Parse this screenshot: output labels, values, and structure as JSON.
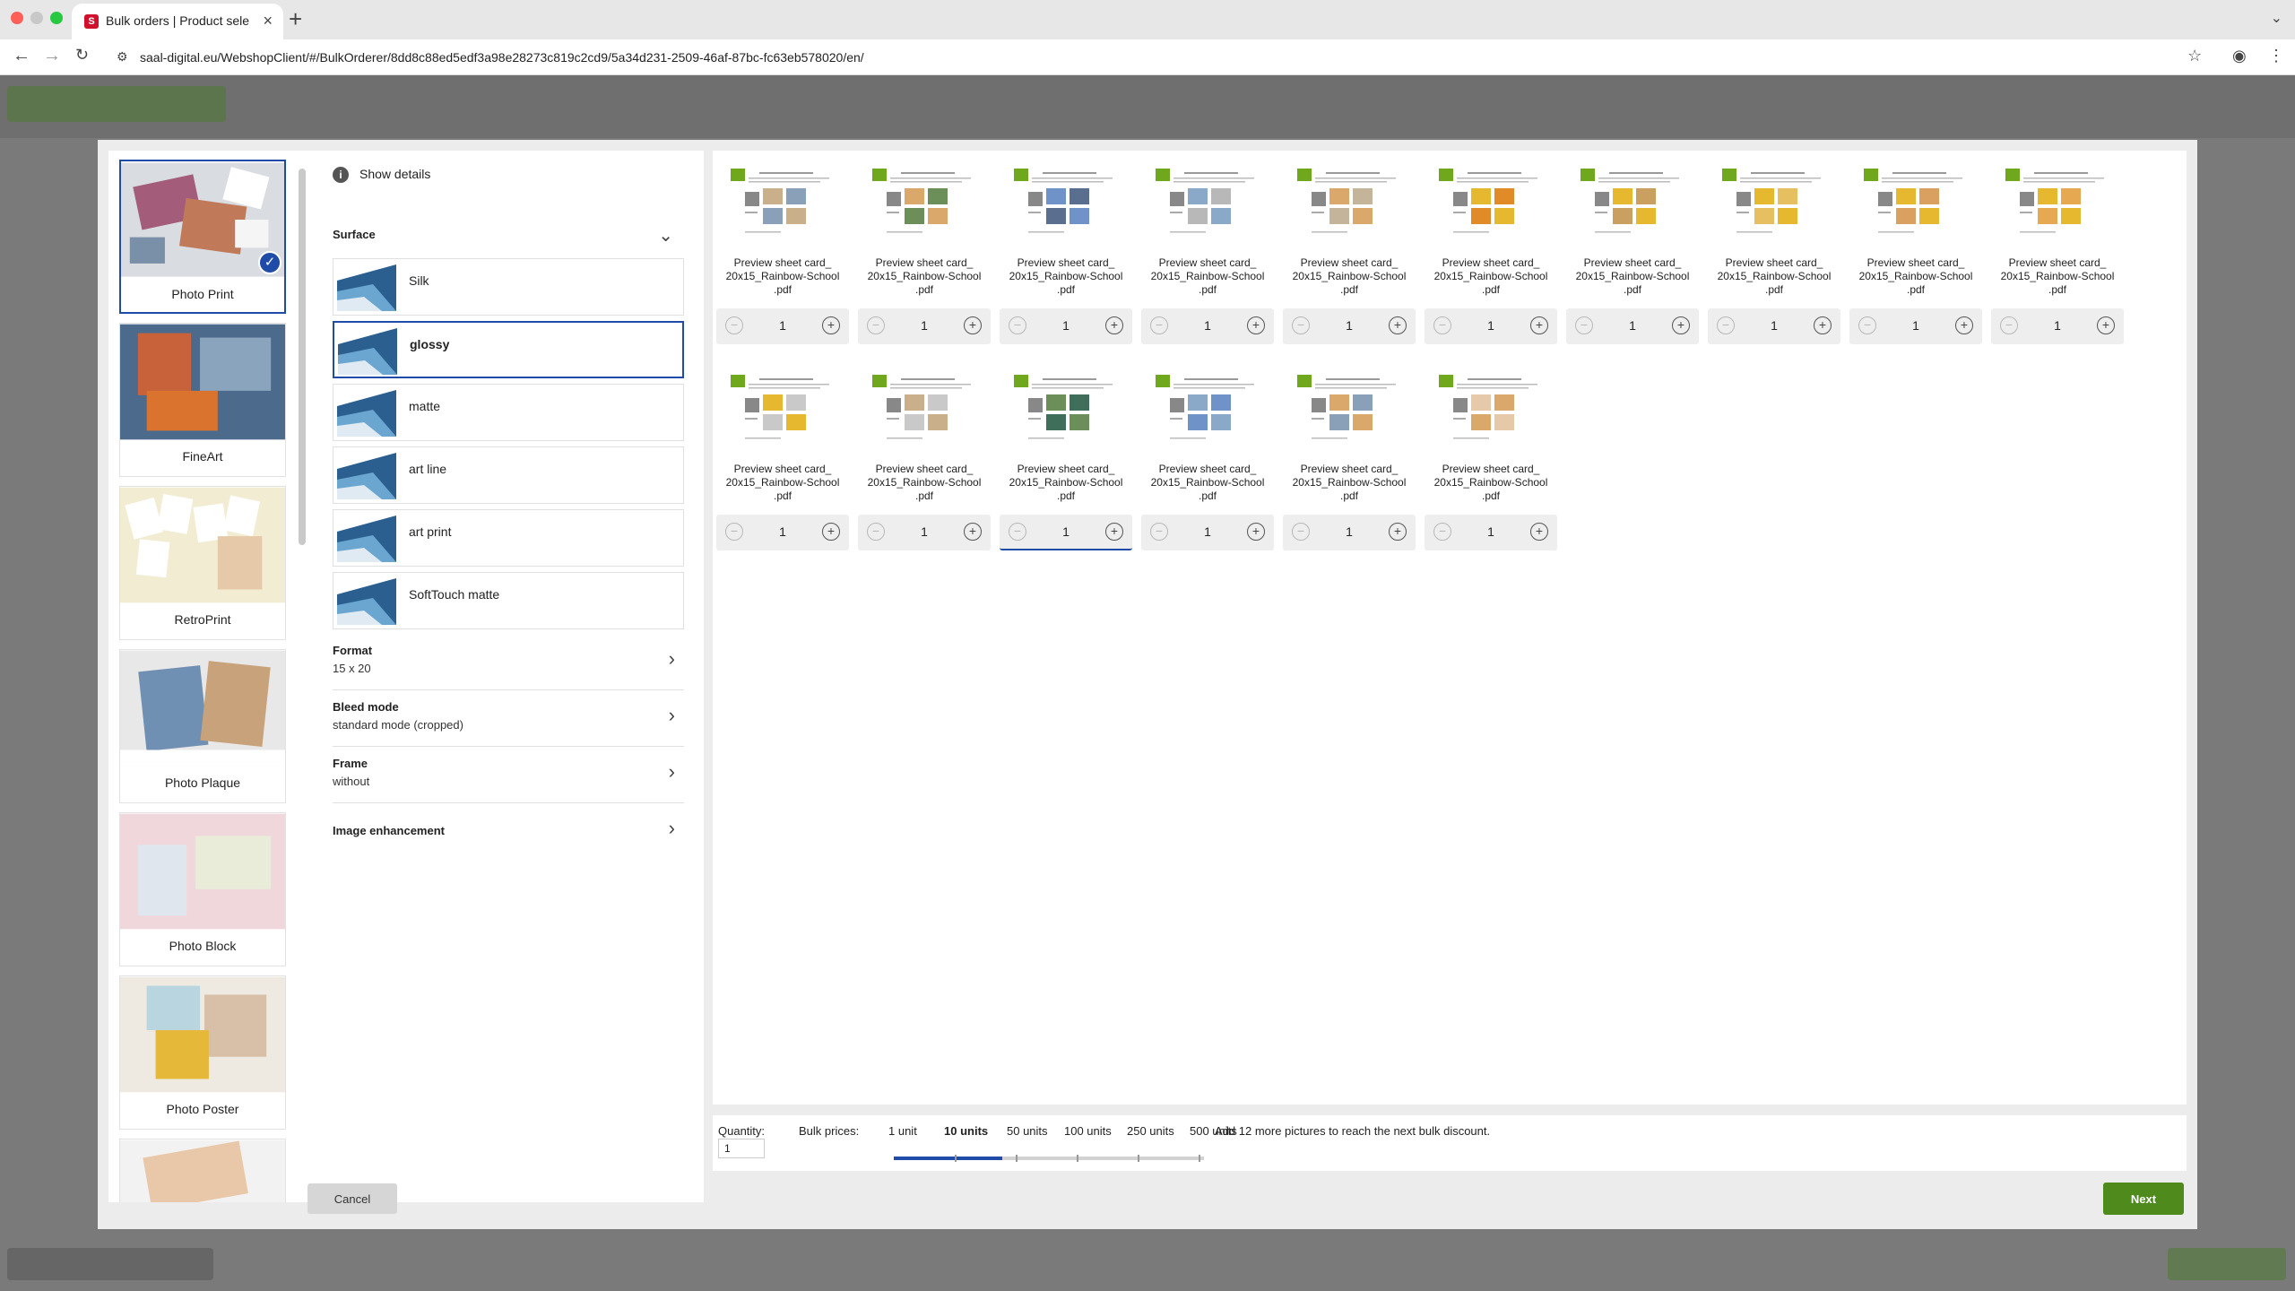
{
  "browser": {
    "tab_title": "Bulk orders | Product selection",
    "url": "saal-digital.eu/WebshopClient/#/BulkOrderer/8dd8c88ed5edf3a98e28273c819c2cd9/5a34d231-2509-46af-87bc-fc63eb578020/en/"
  },
  "products": [
    {
      "label": "Photo Print",
      "selected": true
    },
    {
      "label": "FineArt",
      "selected": false
    },
    {
      "label": "RetroPrint",
      "selected": false
    },
    {
      "label": "Photo Plaque",
      "selected": false
    },
    {
      "label": "Photo Block",
      "selected": false
    },
    {
      "label": "Photo Poster",
      "selected": false
    },
    {
      "label": "",
      "selected": false
    }
  ],
  "options": {
    "show_details": "Show details",
    "surface_heading": "Surface",
    "surfaces": [
      {
        "label": "Silk",
        "selected": false
      },
      {
        "label": "glossy",
        "selected": true
      },
      {
        "label": "matte",
        "selected": false
      },
      {
        "label": "art line",
        "selected": false
      },
      {
        "label": "art print",
        "selected": false
      },
      {
        "label": "SoftTouch matte",
        "selected": false
      }
    ],
    "rows": [
      {
        "title": "Format",
        "value": "15 x 20"
      },
      {
        "title": "Bleed mode",
        "value": "standard mode (cropped)"
      },
      {
        "title": "Frame",
        "value": "without"
      },
      {
        "title": "Image enhancement",
        "value": ""
      }
    ]
  },
  "cards": [
    {
      "name_line1": "Preview sheet card_",
      "name_line2": "20x15_Rainbow-School",
      "name_line3": ".pdf",
      "quantity": "1"
    },
    {
      "name_line1": "Preview sheet card_",
      "name_line2": "20x15_Rainbow-School",
      "name_line3": ".pdf",
      "quantity": "1"
    },
    {
      "name_line1": "Preview sheet card_",
      "name_line2": "20x15_Rainbow-School",
      "name_line3": ".pdf",
      "quantity": "1"
    },
    {
      "name_line1": "Preview sheet card_",
      "name_line2": "20x15_Rainbow-School",
      "name_line3": ".pdf",
      "quantity": "1"
    },
    {
      "name_line1": "Preview sheet card_",
      "name_line2": "20x15_Rainbow-School",
      "name_line3": ".pdf",
      "quantity": "1"
    },
    {
      "name_line1": "Preview sheet card_",
      "name_line2": "20x15_Rainbow-School",
      "name_line3": ".pdf",
      "quantity": "1"
    },
    {
      "name_line1": "Preview sheet card_",
      "name_line2": "20x15_Rainbow-School",
      "name_line3": ".pdf",
      "quantity": "1"
    },
    {
      "name_line1": "Preview sheet card_",
      "name_line2": "20x15_Rainbow-School",
      "name_line3": ".pdf",
      "quantity": "1"
    },
    {
      "name_line1": "Preview sheet card_",
      "name_line2": "20x15_Rainbow-School",
      "name_line3": ".pdf",
      "quantity": "1"
    },
    {
      "name_line1": "Preview sheet card_",
      "name_line2": "20x15_Rainbow-School",
      "name_line3": ".pdf",
      "quantity": "1"
    },
    {
      "name_line1": "Preview sheet card_",
      "name_line2": "20x15_Rainbow-School",
      "name_line3": ".pdf",
      "quantity": "1"
    },
    {
      "name_line1": "Preview sheet card_",
      "name_line2": "20x15_Rainbow-School",
      "name_line3": ".pdf",
      "quantity": "1"
    },
    {
      "name_line1": "Preview sheet card_",
      "name_line2": "20x15_Rainbow-School",
      "name_line3": ".pdf",
      "quantity": "1"
    },
    {
      "name_line1": "Preview sheet card_",
      "name_line2": "20x15_Rainbow-School",
      "name_line3": ".pdf",
      "quantity": "1"
    },
    {
      "name_line1": "Preview sheet card_",
      "name_line2": "20x15_Rainbow-School",
      "name_line3": ".pdf",
      "quantity": "1"
    },
    {
      "name_line1": "Preview sheet card_",
      "name_line2": "20x15_Rainbow-School",
      "name_line3": ".pdf",
      "quantity": "1"
    }
  ],
  "bulk": {
    "quantity_label": "Quantity:",
    "quantity_value": "1",
    "prices_label": "Bulk prices:",
    "tiers": [
      {
        "label": "1 unit",
        "active": false
      },
      {
        "label": "10 units",
        "active": true
      },
      {
        "label": "50 units",
        "active": false
      },
      {
        "label": "100 units",
        "active": false
      },
      {
        "label": "250 units",
        "active": false
      },
      {
        "label": "500 units",
        "active": false
      }
    ],
    "progress_fraction": 0.35,
    "message": "Add 12 more pictures to reach the next bulk discount."
  },
  "footer": {
    "cancel_label": "Cancel",
    "next_label": "Next"
  },
  "colors": {
    "accent_blue": "#1f4ca8",
    "next_green": "#4f8a1c"
  }
}
